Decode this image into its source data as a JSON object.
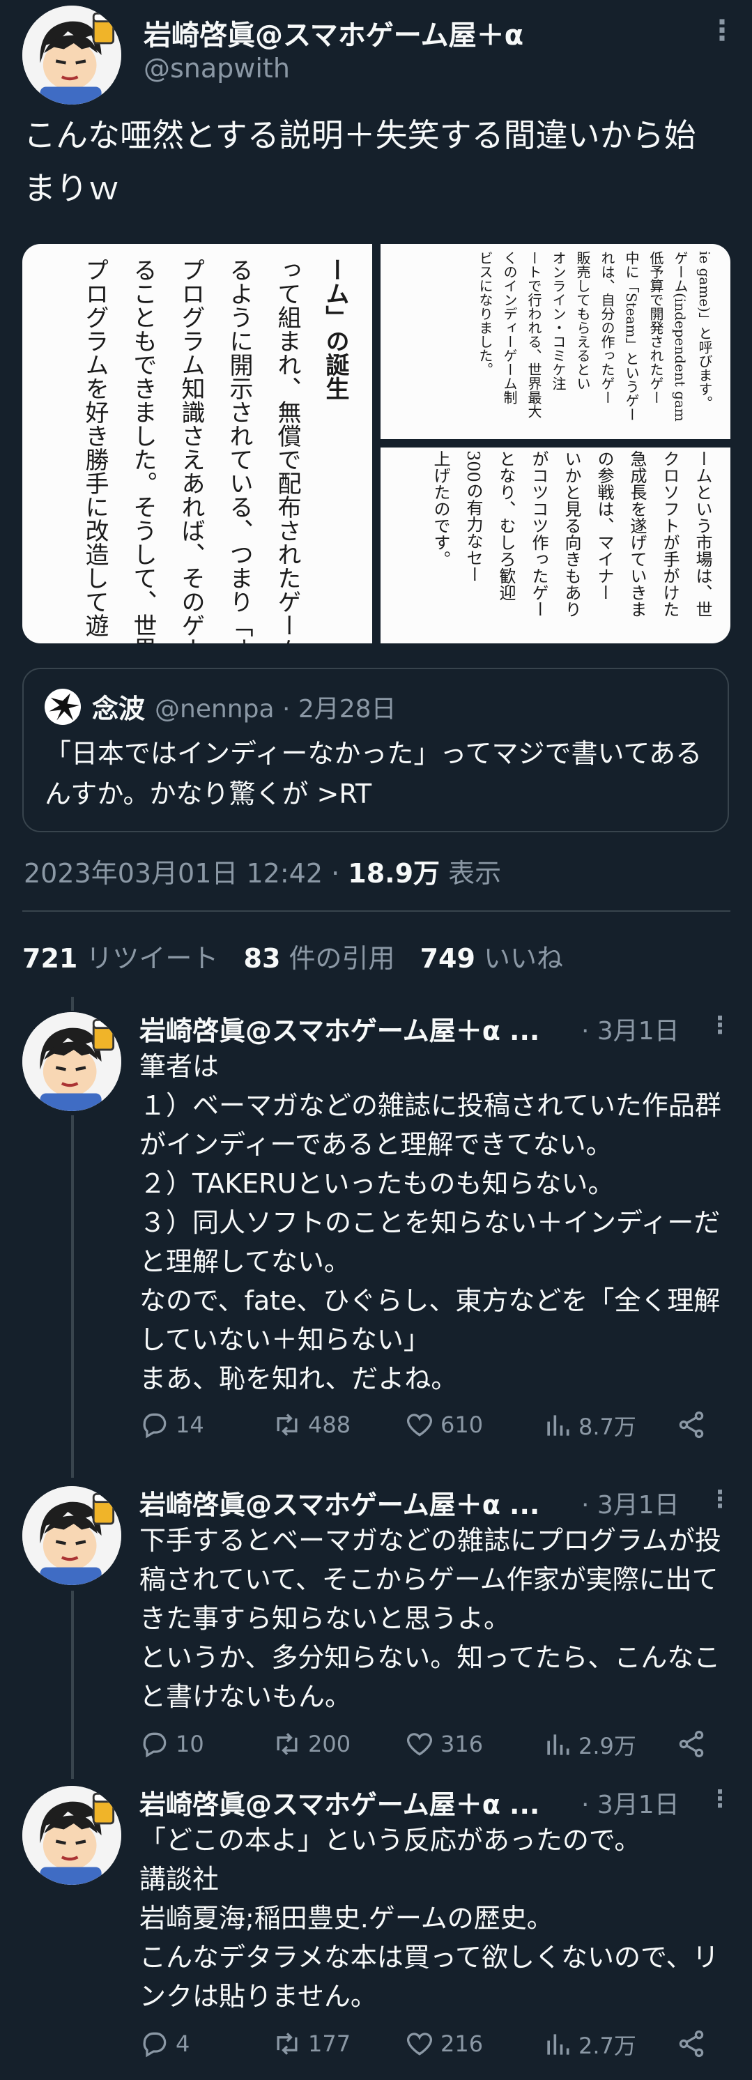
{
  "main_tweet": {
    "author_name": "岩崎啓眞@スマホゲーム屋＋α",
    "handle": "@snapwith",
    "text": "こんな唖然とする説明＋失笑する間違いから始まりｗ",
    "media": {
      "left_image_lines": [
        "ーム」の誕生",
        "って組まれ、無償で配布されたゲームの",
        "るように開示されている、つまり「オープ",
        "プログラム知識さえあれば、そのゲー",
        "ることもできました。そうして、世界中",
        "プログラムを好き勝手に改造して遊"
      ],
      "top_right_lines": [
        "ie game)」と呼びます。",
        "ゲーム(independent gam",
        "低予算で開発されたゲー",
        "中に「Steam」というゲー",
        "れは、自分の作ったゲー",
        "販売してもらえるとい",
        "オンライン・コミケ注",
        "ートで行われる、世界最大",
        "くのインディーゲーム制",
        "ビスになりました。"
      ],
      "bottom_right_lines": [
        "ームという市場は、世",
        "クロソフトが手がけた",
        "急成長を遂げていきま",
        "の参戦は、マイナー",
        "いかと見る向きもあり",
        "がコツコツ作ったゲー",
        "となり、むしろ歓迎",
        "300の有力なセー",
        "上げたのです。"
      ]
    },
    "quote": {
      "author_name": "念波",
      "meta": "@nennpa · 2月28日",
      "text": "「日本ではインディーなかった」ってマジで書いてあるんすか。かなり驚くが >RT"
    },
    "timestamp": "2023年03月01日 12:42 · ",
    "views_value": "18.9万",
    "views_label": " 表示",
    "stats": {
      "retweets_value": "721",
      "retweets_label": " リツイート",
      "quotes_value": "83",
      "quotes_label": " 件の引用",
      "likes_value": "749",
      "likes_label": " いいね"
    }
  },
  "replies": [
    {
      "author_name": "岩崎啓眞@スマホゲーム屋＋α ...",
      "date": "· 3月1日",
      "text": "筆者は\n１）ベーマガなどの雑誌に投稿されていた作品群がインディーであると理解できてない。\n２）TAKERUといったものも知らない。\n３）同人ソフトのことを知らない＋インディーだと理解してない。\nなので、fate、ひぐらし、東方などを「全く理解していない＋知らない」\nまあ、恥を知れ、だよね。",
      "replies_count": "14",
      "retweets_count": "488",
      "likes_count": "610",
      "views_count": "8.7万"
    },
    {
      "author_name": "岩崎啓眞@スマホゲーム屋＋α ...",
      "date": "· 3月1日",
      "text": "下手するとベーマガなどの雑誌にプログラムが投稿されていて、そこからゲーム作家が実際に出てきた事すら知らないと思うよ。\nというか、多分知らない。知ってたら、こんなこと書けないもん。",
      "replies_count": "10",
      "retweets_count": "200",
      "likes_count": "316",
      "views_count": "2.9万"
    },
    {
      "author_name": "岩崎啓眞@スマホゲーム屋＋α ...",
      "date": "· 3月1日",
      "text": "「どこの本よ」という反応があったので。\n講談社\n岩崎夏海;稲田豊史.ゲームの歴史。\nこんなデタラメな本は買って欲しくないので、リンクは貼りません。",
      "replies_count": "4",
      "retweets_count": "177",
      "likes_count": "216",
      "views_count": "2.7万"
    }
  ],
  "icons": {
    "more": "more-vertical-icon",
    "reply": "reply-icon",
    "retweet": "retweet-icon",
    "like": "heart-icon",
    "views": "views-icon",
    "share": "share-icon"
  },
  "colors": {
    "background": "#15202b",
    "text": "#f7f9f9",
    "muted": "#8b98a5",
    "border": "#38444d"
  }
}
